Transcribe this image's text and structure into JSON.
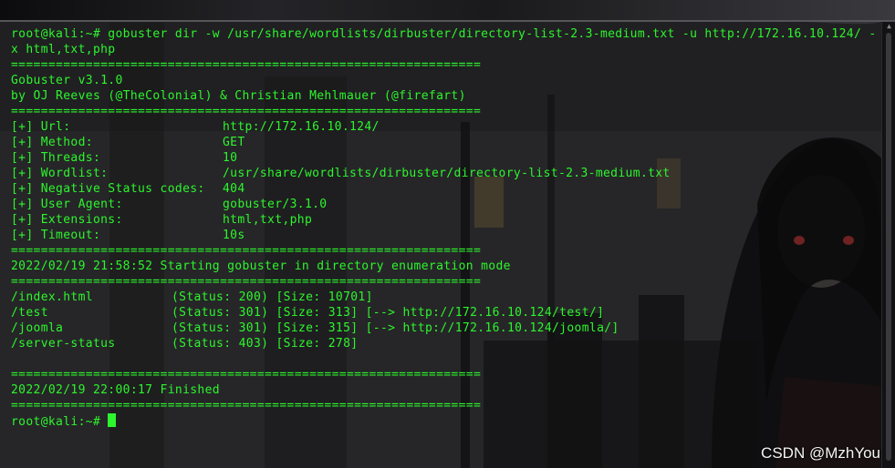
{
  "terminal": {
    "command_line": "root@kali:~# gobuster dir -w /usr/share/wordlists/dirbuster/directory-list-2.3-medium.txt -u http://172.16.10.124/ -x html,txt,php",
    "separator": "===============================================================",
    "banner": [
      "Gobuster v3.1.0",
      "by OJ Reeves (@TheColonial) & Christian Mehlmauer (@firefart)"
    ],
    "config": [
      {
        "key": "[+] Url:",
        "value": "http://172.16.10.124/"
      },
      {
        "key": "[+] Method:",
        "value": "GET"
      },
      {
        "key": "[+] Threads:",
        "value": "10"
      },
      {
        "key": "[+] Wordlist:",
        "value": "/usr/share/wordlists/dirbuster/directory-list-2.3-medium.txt"
      },
      {
        "key": "[+] Negative Status codes:",
        "value": "404"
      },
      {
        "key": "[+] User Agent:",
        "value": "gobuster/3.1.0"
      },
      {
        "key": "[+] Extensions:",
        "value": "html,txt,php"
      },
      {
        "key": "[+] Timeout:",
        "value": "10s"
      }
    ],
    "start_message": "2022/02/19 21:58:52 Starting gobuster in directory enumeration mode",
    "results": [
      {
        "path": "/index.html",
        "status": "(Status: 200) [Size: 10701]"
      },
      {
        "path": "/test",
        "status": "(Status: 301) [Size: 313] [--> http://172.16.10.124/test/]"
      },
      {
        "path": "/joomla",
        "status": "(Status: 301) [Size: 315] [--> http://172.16.10.124/joomla/]"
      },
      {
        "path": "/server-status",
        "status": "(Status: 403) [Size: 278]"
      }
    ],
    "finish_message": "2022/02/19 22:00:17 Finished",
    "prompt": "root@kali:~#"
  },
  "watermark": "CSDN @MzhYou",
  "colors": {
    "terminal_text": "#2df52d",
    "background": "#1c1c1e",
    "watermark": "#f4f4f4"
  }
}
